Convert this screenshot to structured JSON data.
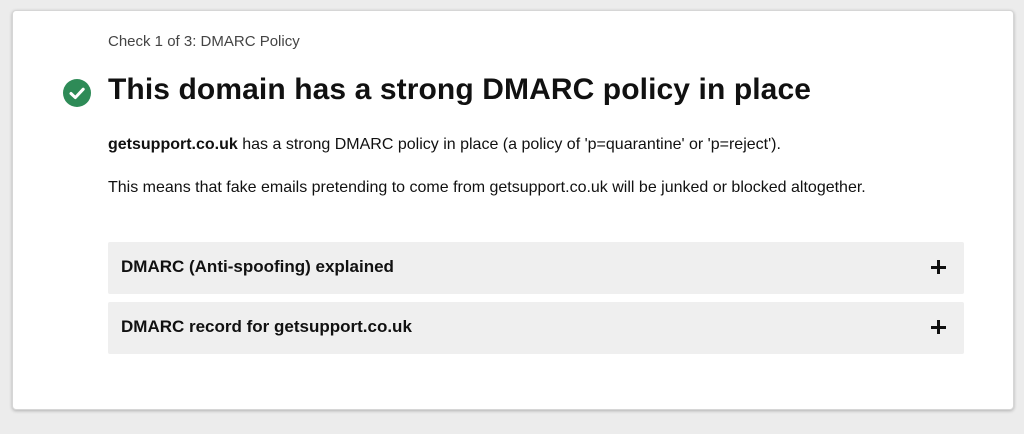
{
  "check": {
    "step_label": "Check 1 of 3: DMARC Policy",
    "status_icon": "check-circle-icon",
    "status_color": "#2e8b57",
    "heading": "This domain has a strong DMARC policy in place"
  },
  "body": {
    "domain": "getsupport.co.uk",
    "summary_rest": " has a strong DMARC policy in place (a policy of 'p=quarantine' or 'p=reject').",
    "explanation": "This means that fake emails pretending to come from getsupport.co.uk will be junked or blocked altogether."
  },
  "accordions": [
    {
      "label": "DMARC (Anti-spoofing) explained",
      "icon": "plus-icon"
    },
    {
      "label": "DMARC record for getsupport.co.uk",
      "icon": "plus-icon"
    }
  ]
}
